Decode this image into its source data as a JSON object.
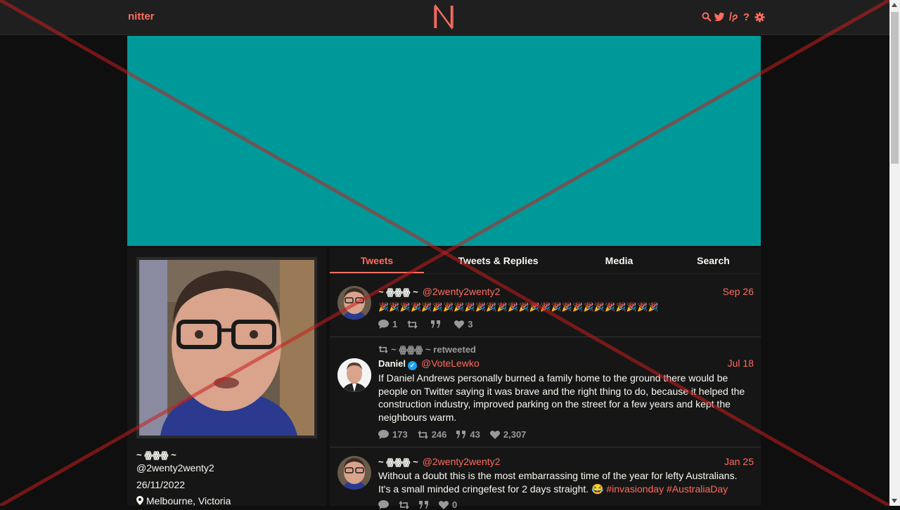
{
  "nav": {
    "brand": "nitter",
    "logo_letter": "N",
    "icons": [
      "search-icon",
      "twitter-icon",
      "lp-icon",
      "help-icon",
      "settings-icon"
    ],
    "icon_glyphs": {
      "help": "?"
    }
  },
  "profile": {
    "name": "~ ꙮꙮꙮ ~",
    "handle": "@2wenty2wenty2",
    "joined": "26/11/2022",
    "location": "Melbourne, Victoria"
  },
  "tabs": [
    "Tweets",
    "Tweets & Replies",
    "Media",
    "Search"
  ],
  "active_tab": "Tweets",
  "tweets": [
    {
      "name": "~ ꙮꙮꙮ ~",
      "handle": "@2wenty2wenty2",
      "date": "Sep 26",
      "text": "🎉🎉🎉🎉🎉🎉🎉🎉🎉🎉🎉🎉🎉🎉🎉🎉🎉🎉🎉🎉🎉🎉🎉🎉🎉🎉",
      "replies": "1",
      "retweets": "",
      "quotes": "",
      "likes": "3"
    },
    {
      "retweet_label": "~ ꙮꙮꙮ ~ retweeted",
      "name": "Daniel",
      "verified": "✓",
      "handle": "@VoteLewko",
      "date": "Jul 18",
      "text": "If Daniel Andrews personally burned a family home to the ground there would be people on Twitter saying it was brave and the right thing to do, because it helped the construction industry, improved parking on the street for a few years and kept the neighbours warm.",
      "replies": "173",
      "retweets": "246",
      "quotes": "43",
      "likes": "2,307"
    },
    {
      "name": "~ ꙮꙮꙮ ~",
      "handle": "@2wenty2wenty2",
      "date": "Jan 25",
      "text_main": "Without a doubt this is the most embarrassing time of the year for lefty Australians. It's a small minded cringefest for 2 days straight. 😂 ",
      "hashtags": [
        "#invasionday",
        "#AustraliaDay"
      ],
      "likes": "0"
    }
  ],
  "colors": {
    "accent": "#ff6c60",
    "banner": "#009999",
    "background": "#0f0f0f",
    "panel": "#161616",
    "overlay_cross": "#c81e1e"
  }
}
